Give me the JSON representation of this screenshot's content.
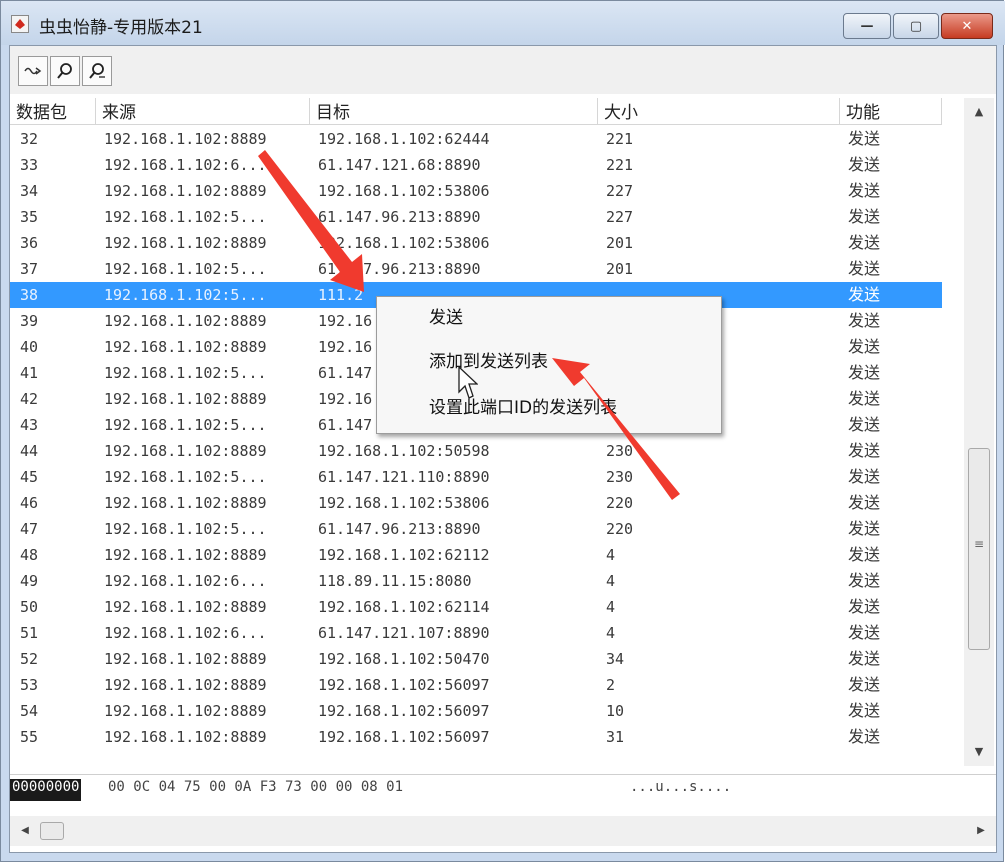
{
  "window": {
    "title": "虫虫怡静-专用版本21",
    "controls": {
      "minimize": "—",
      "maximize": "▢",
      "close": "✕"
    }
  },
  "toolbar": {
    "buttons": [
      {
        "name": "capture-toggle-button",
        "icon": "wave-arrow-icon"
      },
      {
        "name": "search-button",
        "icon": "magnifier-icon"
      },
      {
        "name": "filter-search-button",
        "icon": "magnifier-list-icon"
      }
    ]
  },
  "table": {
    "columns": [
      "数据包",
      "来源",
      "目标",
      "大小",
      "功能"
    ],
    "rows": [
      {
        "no": "32",
        "src": "192.168.1.102:8889",
        "dst": "192.168.1.102:62444",
        "size": "221",
        "fn": "发送"
      },
      {
        "no": "33",
        "src": "192.168.1.102:6...",
        "dst": "61.147.121.68:8890",
        "size": "221",
        "fn": "发送"
      },
      {
        "no": "34",
        "src": "192.168.1.102:8889",
        "dst": "192.168.1.102:53806",
        "size": "227",
        "fn": "发送"
      },
      {
        "no": "35",
        "src": "192.168.1.102:5...",
        "dst": "61.147.96.213:8890",
        "size": "227",
        "fn": "发送"
      },
      {
        "no": "36",
        "src": "192.168.1.102:8889",
        "dst": "192.168.1.102:53806",
        "size": "201",
        "fn": "发送"
      },
      {
        "no": "37",
        "src": "192.168.1.102:5...",
        "dst": "61.147.96.213:8890",
        "size": "201",
        "fn": "发送"
      },
      {
        "no": "38",
        "src": "192.168.1.102:5...",
        "dst": "111.2",
        "size": "",
        "fn": "发送",
        "selected": true
      },
      {
        "no": "39",
        "src": "192.168.1.102:8889",
        "dst": "192.16",
        "size": "",
        "fn": "发送"
      },
      {
        "no": "40",
        "src": "192.168.1.102:8889",
        "dst": "192.16",
        "size": "",
        "fn": "发送"
      },
      {
        "no": "41",
        "src": "192.168.1.102:5...",
        "dst": "61.147",
        "size": "",
        "fn": "发送"
      },
      {
        "no": "42",
        "src": "192.168.1.102:8889",
        "dst": "192.16",
        "size": "",
        "fn": "发送"
      },
      {
        "no": "43",
        "src": "192.168.1.102:5...",
        "dst": "61.147",
        "size": "",
        "fn": "发送"
      },
      {
        "no": "44",
        "src": "192.168.1.102:8889",
        "dst": "192.168.1.102:50598",
        "size": "230",
        "fn": "发送"
      },
      {
        "no": "45",
        "src": "192.168.1.102:5...",
        "dst": "61.147.121.110:8890",
        "size": "230",
        "fn": "发送"
      },
      {
        "no": "46",
        "src": "192.168.1.102:8889",
        "dst": "192.168.1.102:53806",
        "size": "220",
        "fn": "发送"
      },
      {
        "no": "47",
        "src": "192.168.1.102:5...",
        "dst": "61.147.96.213:8890",
        "size": "220",
        "fn": "发送"
      },
      {
        "no": "48",
        "src": "192.168.1.102:8889",
        "dst": "192.168.1.102:62112",
        "size": "4",
        "fn": "发送"
      },
      {
        "no": "49",
        "src": "192.168.1.102:6...",
        "dst": "118.89.11.15:8080",
        "size": "4",
        "fn": "发送"
      },
      {
        "no": "50",
        "src": "192.168.1.102:8889",
        "dst": "192.168.1.102:62114",
        "size": "4",
        "fn": "发送"
      },
      {
        "no": "51",
        "src": "192.168.1.102:6...",
        "dst": "61.147.121.107:8890",
        "size": "4",
        "fn": "发送"
      },
      {
        "no": "52",
        "src": "192.168.1.102:8889",
        "dst": "192.168.1.102:50470",
        "size": "34",
        "fn": "发送"
      },
      {
        "no": "53",
        "src": "192.168.1.102:8889",
        "dst": "192.168.1.102:56097",
        "size": "2",
        "fn": "发送"
      },
      {
        "no": "54",
        "src": "192.168.1.102:8889",
        "dst": "192.168.1.102:56097",
        "size": "10",
        "fn": "发送"
      },
      {
        "no": "55",
        "src": "192.168.1.102:8889",
        "dst": "192.168.1.102:56097",
        "size": "31",
        "fn": "发送"
      }
    ]
  },
  "context_menu": {
    "items": [
      "发送",
      "添加到发送列表",
      "设置此端口ID的发送列表"
    ]
  },
  "hex_view": {
    "address": "00000000",
    "bytes": "00 0C 04 75 00 0A F3 73 00 00 08 01",
    "ascii": "...u...s...."
  },
  "colors": {
    "selection": "#3399ff",
    "annotation_arrow": "#f03a2e",
    "close_button": "#c63b22"
  }
}
